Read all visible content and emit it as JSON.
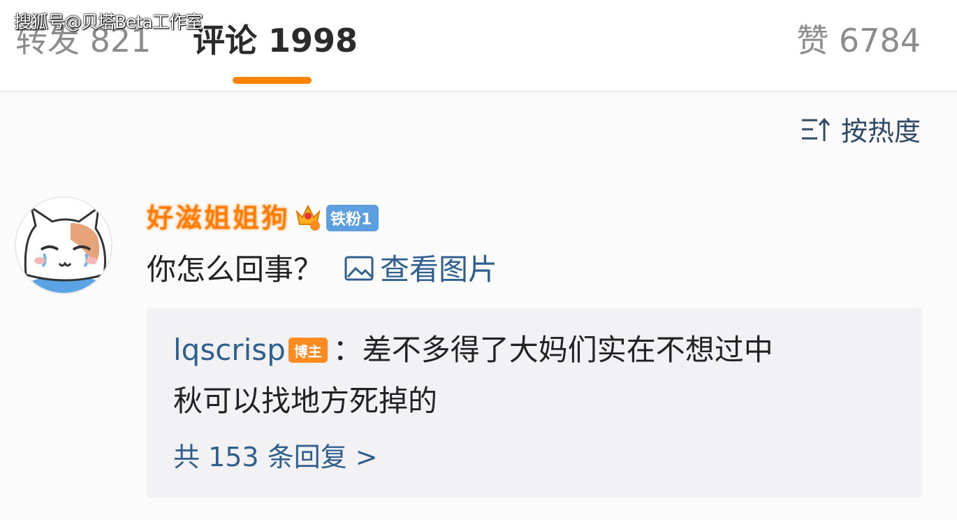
{
  "watermark": "搜狐号@贝塔Beta工作室",
  "tabs": {
    "repost": "转发 821",
    "comments": "评论 1998",
    "likes": "赞 6784"
  },
  "colors": {
    "accent": "#ff8200",
    "link": "#2f5f8f",
    "fan_badge": "#5b9fe0",
    "author_badge": "#ff8a1f"
  },
  "sort": {
    "icon": "sort-icon",
    "label": "按热度"
  },
  "comment": {
    "username": "好滋姐姐狗",
    "fan_badge": "铁粉1",
    "text": "你怎么回事？",
    "view_image_label": "查看图片"
  },
  "reply": {
    "user": "lqscrisp",
    "author_badge": "博主",
    "text_line1": "：差不多得了大妈们实在不想过中",
    "text_line2": "秋可以找地方死掉的",
    "count_label": "共 153 条回复",
    "count_arrow": ">"
  }
}
